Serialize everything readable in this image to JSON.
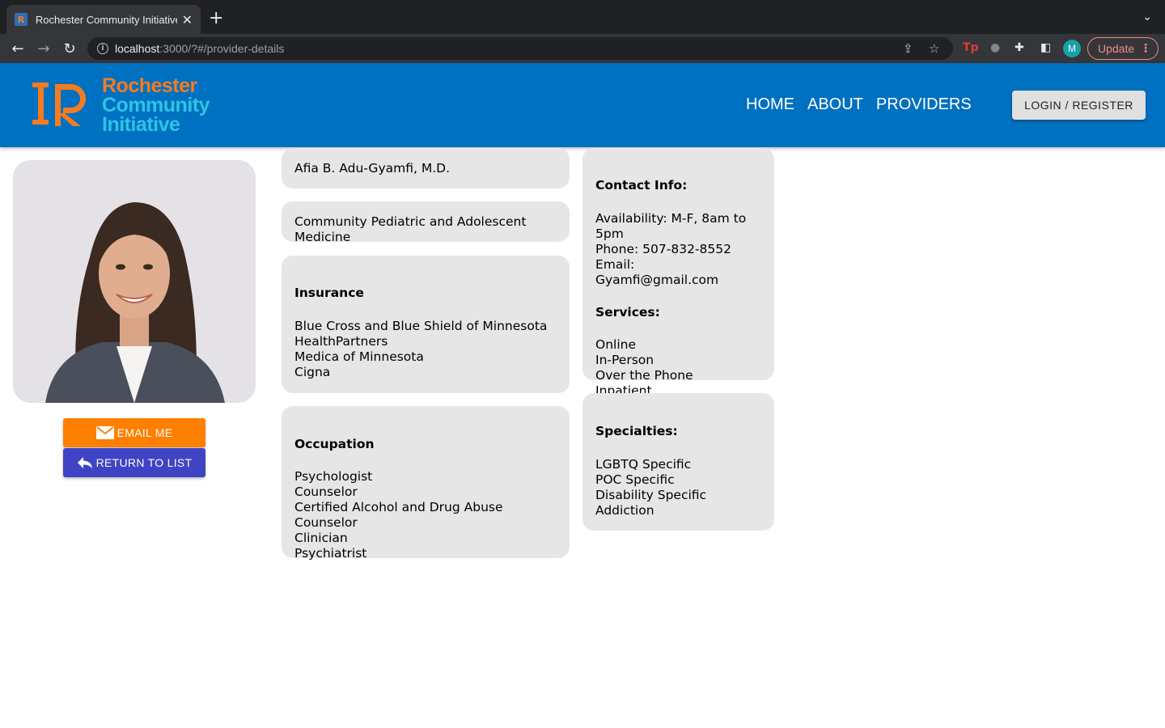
{
  "browser": {
    "tab_title": "Rochester Community Initiative",
    "url_host": "localhost",
    "url_rest": ":3000/?#/provider-details",
    "update_label": "Update",
    "profile_initial": "M"
  },
  "header": {
    "logo_line1": "Rochester",
    "logo_line2": "Community",
    "logo_line3": "Initiative",
    "nav": [
      "HOME",
      "ABOUT",
      "PROVIDERS"
    ],
    "login_label": "LOGIN / REGISTER"
  },
  "actions": {
    "email_label": "EMAIL ME",
    "return_label": "RETURN TO LIST"
  },
  "provider": {
    "name": "Afia B. Adu-Gyamfi, M.D.",
    "practice": "Community Pediatric and Adolescent Medicine",
    "insurance_heading": "Insurance",
    "insurance": [
      "Blue Cross and Blue Shield of Minnesota",
      "HealthPartners",
      "Medica of Minnesota",
      "Cigna"
    ],
    "occupation_heading": "Occupation",
    "occupations": [
      "Psychologist",
      "Counselor",
      "Certified Alcohol and Drug Abuse Counselor",
      "Clinician",
      "Psychiatrist"
    ],
    "contact_heading": "Contact Info:",
    "availability": "Availability: M-F, 8am to 5pm",
    "phone": "Phone: 507-832-8552",
    "email": "Email: Gyamfi@gmail.com",
    "services_heading": "Services:",
    "services": [
      "Online",
      "In-Person",
      "Over the Phone",
      "Inpatient"
    ],
    "specialties_heading": "Specialties:",
    "specialties": [
      "LGBTQ Specific",
      "POC Specific",
      "Disability Specific",
      "Addiction"
    ]
  },
  "colors": {
    "header_bg": "#0070c0",
    "logo_orange": "#f47b20",
    "logo_cyan": "#2ec4e6",
    "email_button": "#ff7f00",
    "return_button": "#3f44c4",
    "card_bg": "#e6e6e6"
  }
}
